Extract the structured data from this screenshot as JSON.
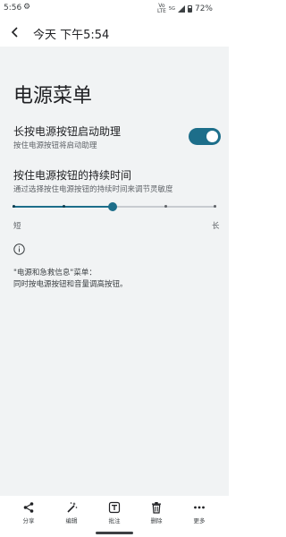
{
  "status_bar": {
    "time": "5:56",
    "network_label_top": "Vo",
    "network_label_bottom": "LTE",
    "signal_label": "5G",
    "battery": "72%"
  },
  "screenshot_header": {
    "title": "今天 下午5:54"
  },
  "page": {
    "title": "电源菜单",
    "setting_assistant": {
      "title": "长按电源按钮启动助理",
      "subtitle": "按住电源按钮将启动助理",
      "enabled": true
    },
    "setting_duration": {
      "title": "按住电源按钮的持续时间",
      "subtitle": "通过选择按住电源按钮的持续时间来调节灵敏度",
      "min_label": "短",
      "max_label": "长",
      "steps": 5,
      "selected_step": 3
    },
    "info_text_line1": "\"电源和急救信息\"菜单：",
    "info_text_line2": "同时按电源按钮和音量调高按钮。"
  },
  "bottom_actions": [
    {
      "label": "分享",
      "icon": "share-icon"
    },
    {
      "label": "编辑",
      "icon": "magic-wand-icon"
    },
    {
      "label": "批注",
      "icon": "text-annotate-icon"
    },
    {
      "label": "删除",
      "icon": "trash-icon"
    },
    {
      "label": "更多",
      "icon": "more-icon"
    }
  ],
  "colors": {
    "accent": "#1d6e8a",
    "background": "#f1f3f4"
  }
}
